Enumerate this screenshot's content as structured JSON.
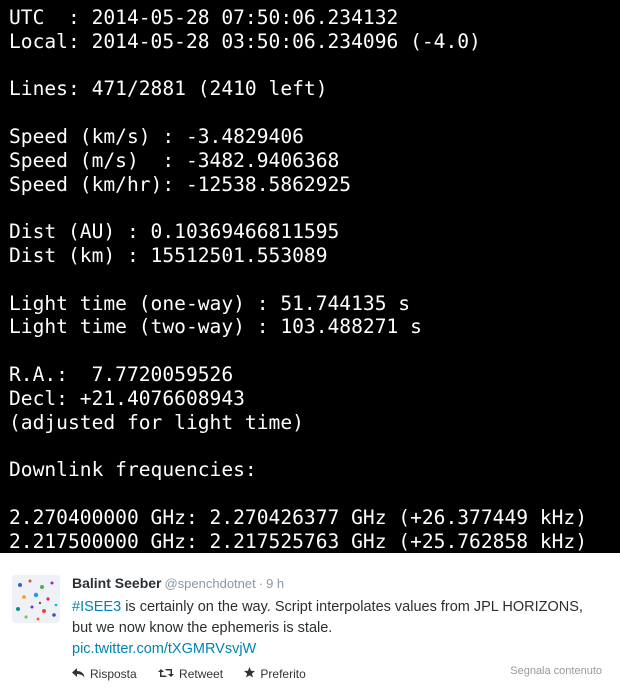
{
  "terminal": {
    "lines": [
      "UTC  : 2014-05-28 07:50:06.234132",
      "Local: 2014-05-28 03:50:06.234096 (-4.0)",
      "",
      "Lines: 471/2881 (2410 left)",
      "",
      "Speed (km/s) : -3.4829406",
      "Speed (m/s)  : -3482.9406368",
      "Speed (km/hr): -12538.5862925",
      "",
      "Dist (AU) : 0.10369466811595",
      "Dist (km) : 15512501.553089",
      "",
      "Light time (one-way) : 51.744135 s",
      "Light time (two-way) : 103.488271 s",
      "",
      "R.A.:  7.7720059526",
      "Decl: +21.4076608943",
      "(adjusted for light time)",
      "",
      "Downlink frequencies:",
      "",
      "2.270400000 GHz: 2.270426377 GHz (+26.377449 kHz)",
      "2.217500000 GHz: 2.217525763 GHz (+25.762858 kHz)"
    ]
  },
  "tweet": {
    "fullname": "Balint Seeber",
    "username": "@spenchdotnet",
    "separator": "·",
    "time": "9 h",
    "hashtag": "#ISEE3",
    "text": " is certainly on the way. Script interpolates values from JPL HORIZONS, but we now know the ephemeris is stale.",
    "link": "pic.twitter.com/tXGMRVsvjW",
    "report": "Segnala contenuto",
    "actions": {
      "reply": "Risposta",
      "retweet": "Retweet",
      "favorite": "Preferito"
    }
  },
  "colors": {
    "terminal_bg": "#000000",
    "terminal_fg": "#ffffff",
    "link": "#0084b4",
    "muted": "#8899a6"
  }
}
